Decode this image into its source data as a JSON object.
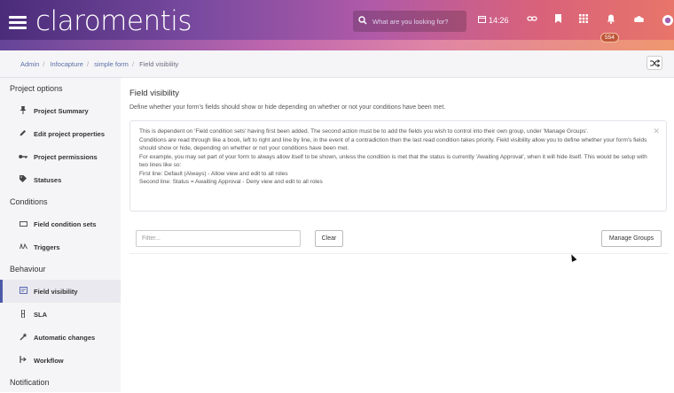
{
  "header": {
    "logo": "claromentis",
    "search_placeholder": "What are you looking for?",
    "time": "14:26",
    "notification_count": "554",
    "icons": [
      "menu-icon",
      "search-icon",
      "calendar-icon",
      "link-icon",
      "bookmark-icon",
      "apps-icon",
      "bell-icon",
      "cloud-icon",
      "user-icon"
    ]
  },
  "breadcrumb": {
    "items": [
      "Admin",
      "Infocapture",
      "simple form",
      "Field visibility"
    ]
  },
  "sidebar": {
    "sections": [
      {
        "title": "Project options",
        "items": [
          {
            "label": "Project Summary",
            "icon": "pin-icon"
          },
          {
            "label": "Edit project properties",
            "icon": "pencil-icon"
          },
          {
            "label": "Project permissions",
            "icon": "key-icon"
          },
          {
            "label": "Statuses",
            "icon": "tag-icon"
          }
        ]
      },
      {
        "title": "Conditions",
        "items": [
          {
            "label": "Field condition sets",
            "icon": "list-icon"
          },
          {
            "label": "Triggers",
            "icon": "trigger-icon"
          }
        ]
      },
      {
        "title": "Behaviour",
        "items": [
          {
            "label": "Field visibility",
            "icon": "visibility-icon",
            "active": true
          },
          {
            "label": "SLA",
            "icon": "hourglass-icon"
          },
          {
            "label": "Automatic changes",
            "icon": "magic-icon"
          },
          {
            "label": "Workflow",
            "icon": "workflow-icon"
          }
        ]
      },
      {
        "title": "Notification",
        "items": []
      }
    ]
  },
  "main": {
    "title": "Field visibility",
    "description": "Define whether your form's fields should show or hide depending on whether or not your conditions have been met.",
    "info_lines": [
      "This is dependent on 'Field condition sets' having first been added. The second action must be to add the fields you wish to control into their own group, under 'Manage Groups'.",
      "Conditions are read through like a book, left to right and line by line, in the event of a contradiction then the last read condition takes priority. Field visibility allow you to define whether your form's fields should show or hide, depending on whether or not your conditions have been met.",
      "For example, you may set part of your form to always allow itself to be shown, unless the condition is met that the status is currently 'Awaiting Approval', when it will hide itself. This would be setup with two lines like so:",
      "First line: Default (Always) - Allow view and edit to all roles",
      "Second line: Status = Awaiting Approval - Deny view and edit to all roles"
    ],
    "filter_placeholder": "Filter...",
    "clear_label": "Clear",
    "manage_groups_label": "Manage Groups"
  }
}
